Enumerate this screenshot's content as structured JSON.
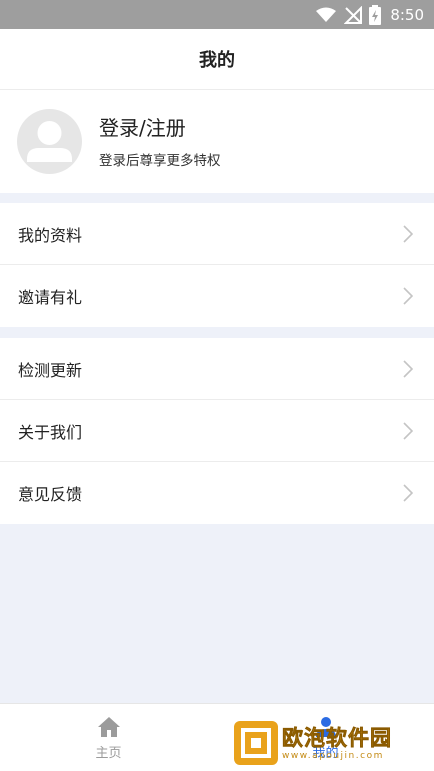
{
  "status_bar": {
    "time": "8:50"
  },
  "header": {
    "title": "我的"
  },
  "profile": {
    "name": "登录/注册",
    "subtitle": "登录后尊享更多特权"
  },
  "menu_group_1": [
    {
      "label": "我的资料"
    },
    {
      "label": "邀请有礼"
    }
  ],
  "menu_group_2": [
    {
      "label": "检测更新"
    },
    {
      "label": "关于我们"
    },
    {
      "label": "意见反馈"
    }
  ],
  "tabbar": {
    "tabs": [
      {
        "label": "主页",
        "icon": "home-icon",
        "active": false
      },
      {
        "label": "我的",
        "icon": "user-icon",
        "active": true
      }
    ]
  },
  "watermark": {
    "title": "欧泡软件园",
    "url": "www.apoujin.com"
  },
  "colors": {
    "accent": "#2b6be3",
    "background": "#eef1f9",
    "status_bar": "#9e9e9e"
  }
}
